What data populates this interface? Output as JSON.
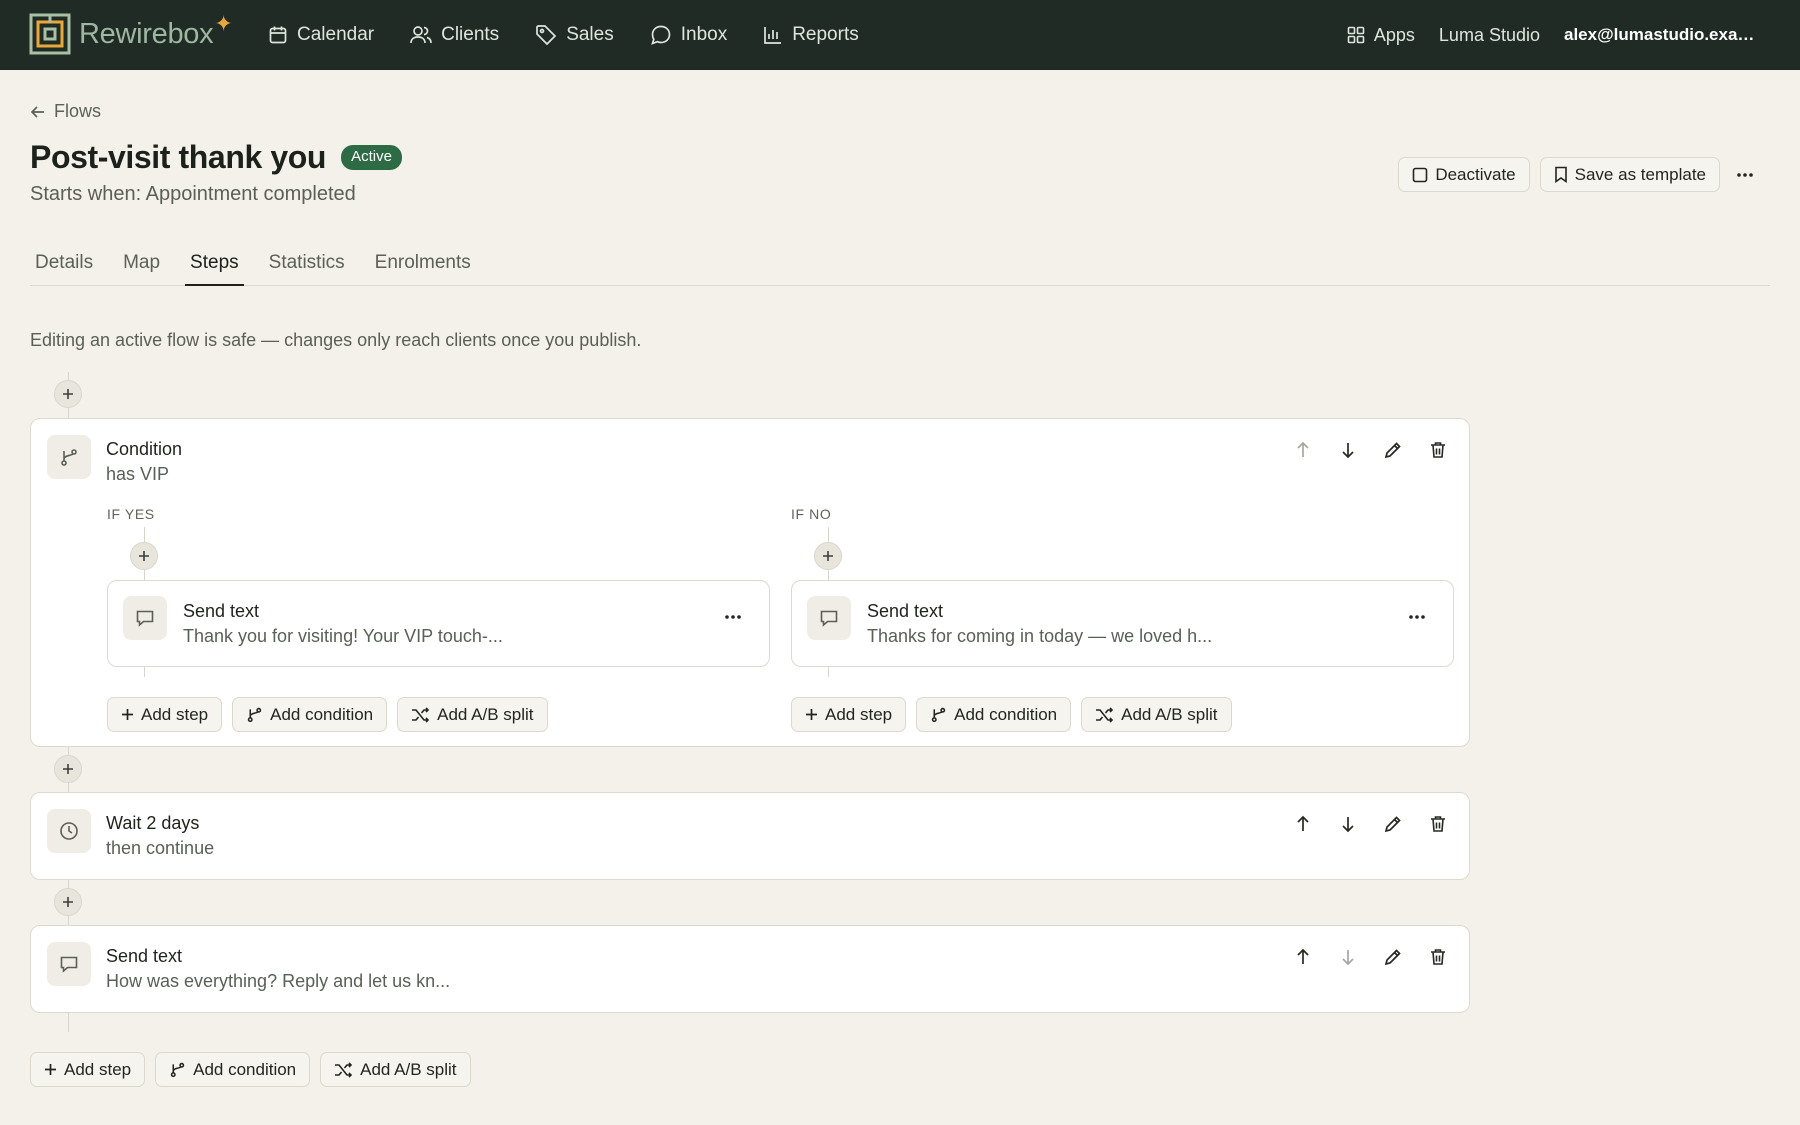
{
  "app": {
    "name": "Rewirebox"
  },
  "nav": [
    {
      "label": "Calendar",
      "icon": "calendar-icon"
    },
    {
      "label": "Clients",
      "icon": "users-icon"
    },
    {
      "label": "Sales",
      "icon": "tag-icon"
    },
    {
      "label": "Inbox",
      "icon": "chat-icon"
    },
    {
      "label": "Reports",
      "icon": "bar-chart-icon"
    }
  ],
  "topbar": {
    "apps_label": "Apps",
    "studio": "Luma Studio",
    "account": "alex@lumastudio.example.com"
  },
  "header": {
    "back_label": "Flows",
    "title": "Post-visit thank you",
    "status": "Active",
    "trigger": "Starts when: Appointment completed",
    "deactivate_label": "Deactivate",
    "save_template_label": "Save as template"
  },
  "tabs": [
    {
      "label": "Details"
    },
    {
      "label": "Map"
    },
    {
      "label": "Steps",
      "active": true
    },
    {
      "label": "Statistics"
    },
    {
      "label": "Enrolments"
    }
  ],
  "notice": "Editing an active flow is safe — changes only reach clients once you publish.",
  "steps": [
    {
      "type": "condition",
      "title": "Condition",
      "subtitle": "has VIP",
      "branches": [
        {
          "label": "IF YES",
          "step_title": "Send text",
          "step_sub": "Thank you for visiting! Your VIP touch-..."
        },
        {
          "label": "IF NO",
          "step_title": "Send text",
          "step_sub": "Thanks for coming in today — we loved h..."
        }
      ]
    },
    {
      "type": "wait",
      "title": "Wait 2 days",
      "subtitle": "then continue"
    },
    {
      "type": "text",
      "title": "Send text",
      "subtitle": "How was everything? Reply and let us kn..."
    }
  ],
  "actions": {
    "add_step": "Add step",
    "add_condition": "Add condition",
    "add_ab": "Add A/B split"
  },
  "colors": {
    "topbar": "#1f2b24",
    "background": "#f3f1ea",
    "badge": "#2d6b44",
    "logo_accent": "#e8a83a"
  }
}
